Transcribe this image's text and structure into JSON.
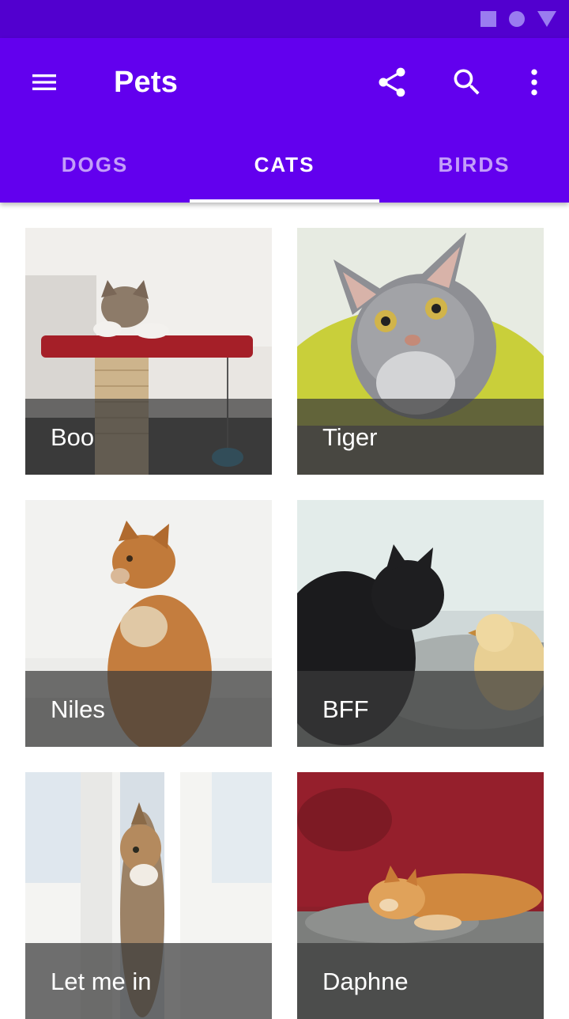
{
  "app": {
    "title": "Pets"
  },
  "toolbar": {
    "icons": [
      "menu-icon",
      "share-icon",
      "search-icon",
      "more-vert-icon"
    ]
  },
  "status_bar": {
    "icons": [
      "square-icon",
      "circle-icon",
      "triangle-icon"
    ]
  },
  "tabs": [
    {
      "label": "DOGS",
      "selected": false
    },
    {
      "label": "CATS",
      "selected": true
    },
    {
      "label": "BIRDS",
      "selected": false
    }
  ],
  "cats": [
    {
      "name": "Boo"
    },
    {
      "name": "Tiger"
    },
    {
      "name": "Niles"
    },
    {
      "name": "BFF"
    },
    {
      "name": "Let me in"
    },
    {
      "name": "Daphne"
    }
  ],
  "colors": {
    "primary": "#6200ee",
    "primary_dark": "#5200cf",
    "tab_indicator": "#ffffff",
    "caption_scrim": "rgba(58,58,58,0.72)"
  }
}
